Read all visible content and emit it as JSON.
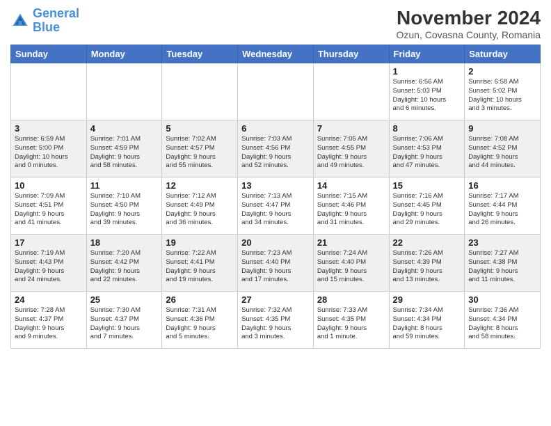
{
  "header": {
    "logo_line1": "General",
    "logo_line2": "Blue",
    "month": "November 2024",
    "location": "Ozun, Covasna County, Romania"
  },
  "days_of_week": [
    "Sunday",
    "Monday",
    "Tuesday",
    "Wednesday",
    "Thursday",
    "Friday",
    "Saturday"
  ],
  "weeks": [
    [
      {
        "day": "",
        "info": ""
      },
      {
        "day": "",
        "info": ""
      },
      {
        "day": "",
        "info": ""
      },
      {
        "day": "",
        "info": ""
      },
      {
        "day": "",
        "info": ""
      },
      {
        "day": "1",
        "info": "Sunrise: 6:56 AM\nSunset: 5:03 PM\nDaylight: 10 hours\nand 6 minutes."
      },
      {
        "day": "2",
        "info": "Sunrise: 6:58 AM\nSunset: 5:02 PM\nDaylight: 10 hours\nand 3 minutes."
      }
    ],
    [
      {
        "day": "3",
        "info": "Sunrise: 6:59 AM\nSunset: 5:00 PM\nDaylight: 10 hours\nand 0 minutes."
      },
      {
        "day": "4",
        "info": "Sunrise: 7:01 AM\nSunset: 4:59 PM\nDaylight: 9 hours\nand 58 minutes."
      },
      {
        "day": "5",
        "info": "Sunrise: 7:02 AM\nSunset: 4:57 PM\nDaylight: 9 hours\nand 55 minutes."
      },
      {
        "day": "6",
        "info": "Sunrise: 7:03 AM\nSunset: 4:56 PM\nDaylight: 9 hours\nand 52 minutes."
      },
      {
        "day": "7",
        "info": "Sunrise: 7:05 AM\nSunset: 4:55 PM\nDaylight: 9 hours\nand 49 minutes."
      },
      {
        "day": "8",
        "info": "Sunrise: 7:06 AM\nSunset: 4:53 PM\nDaylight: 9 hours\nand 47 minutes."
      },
      {
        "day": "9",
        "info": "Sunrise: 7:08 AM\nSunset: 4:52 PM\nDaylight: 9 hours\nand 44 minutes."
      }
    ],
    [
      {
        "day": "10",
        "info": "Sunrise: 7:09 AM\nSunset: 4:51 PM\nDaylight: 9 hours\nand 41 minutes."
      },
      {
        "day": "11",
        "info": "Sunrise: 7:10 AM\nSunset: 4:50 PM\nDaylight: 9 hours\nand 39 minutes."
      },
      {
        "day": "12",
        "info": "Sunrise: 7:12 AM\nSunset: 4:49 PM\nDaylight: 9 hours\nand 36 minutes."
      },
      {
        "day": "13",
        "info": "Sunrise: 7:13 AM\nSunset: 4:47 PM\nDaylight: 9 hours\nand 34 minutes."
      },
      {
        "day": "14",
        "info": "Sunrise: 7:15 AM\nSunset: 4:46 PM\nDaylight: 9 hours\nand 31 minutes."
      },
      {
        "day": "15",
        "info": "Sunrise: 7:16 AM\nSunset: 4:45 PM\nDaylight: 9 hours\nand 29 minutes."
      },
      {
        "day": "16",
        "info": "Sunrise: 7:17 AM\nSunset: 4:44 PM\nDaylight: 9 hours\nand 26 minutes."
      }
    ],
    [
      {
        "day": "17",
        "info": "Sunrise: 7:19 AM\nSunset: 4:43 PM\nDaylight: 9 hours\nand 24 minutes."
      },
      {
        "day": "18",
        "info": "Sunrise: 7:20 AM\nSunset: 4:42 PM\nDaylight: 9 hours\nand 22 minutes."
      },
      {
        "day": "19",
        "info": "Sunrise: 7:22 AM\nSunset: 4:41 PM\nDaylight: 9 hours\nand 19 minutes."
      },
      {
        "day": "20",
        "info": "Sunrise: 7:23 AM\nSunset: 4:40 PM\nDaylight: 9 hours\nand 17 minutes."
      },
      {
        "day": "21",
        "info": "Sunrise: 7:24 AM\nSunset: 4:40 PM\nDaylight: 9 hours\nand 15 minutes."
      },
      {
        "day": "22",
        "info": "Sunrise: 7:26 AM\nSunset: 4:39 PM\nDaylight: 9 hours\nand 13 minutes."
      },
      {
        "day": "23",
        "info": "Sunrise: 7:27 AM\nSunset: 4:38 PM\nDaylight: 9 hours\nand 11 minutes."
      }
    ],
    [
      {
        "day": "24",
        "info": "Sunrise: 7:28 AM\nSunset: 4:37 PM\nDaylight: 9 hours\nand 9 minutes."
      },
      {
        "day": "25",
        "info": "Sunrise: 7:30 AM\nSunset: 4:37 PM\nDaylight: 9 hours\nand 7 minutes."
      },
      {
        "day": "26",
        "info": "Sunrise: 7:31 AM\nSunset: 4:36 PM\nDaylight: 9 hours\nand 5 minutes."
      },
      {
        "day": "27",
        "info": "Sunrise: 7:32 AM\nSunset: 4:35 PM\nDaylight: 9 hours\nand 3 minutes."
      },
      {
        "day": "28",
        "info": "Sunrise: 7:33 AM\nSunset: 4:35 PM\nDaylight: 9 hours\nand 1 minute."
      },
      {
        "day": "29",
        "info": "Sunrise: 7:34 AM\nSunset: 4:34 PM\nDaylight: 8 hours\nand 59 minutes."
      },
      {
        "day": "30",
        "info": "Sunrise: 7:36 AM\nSunset: 4:34 PM\nDaylight: 8 hours\nand 58 minutes."
      }
    ]
  ]
}
